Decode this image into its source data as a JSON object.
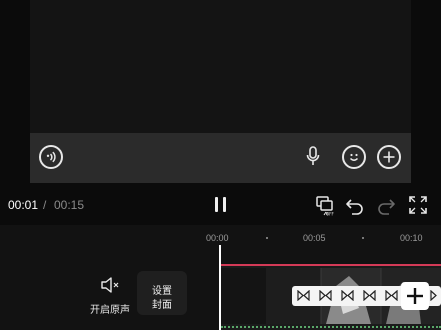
{
  "playback": {
    "current_time": "00:01",
    "separator": "/",
    "total_time": "00:15"
  },
  "timeline": {
    "ruler_labels": [
      "00:00",
      "00:05",
      "00:10"
    ]
  },
  "tools": {
    "mute_original_label": "开启原声",
    "set_cover_label_line1": "设置",
    "set_cover_label_line2": "封面"
  },
  "icons": {
    "voice": "voice-input-icon",
    "mic": "microphone-icon",
    "emoji": "emoji-icon",
    "plus": "plus-icon",
    "pause": "pause-icon",
    "screen_off": "screen-off-icon",
    "undo": "undo-icon",
    "redo": "redo-icon",
    "fullscreen": "fullscreen-icon",
    "mute": "speaker-muted-icon",
    "add_clip": "add-clip-icon",
    "transition": "transition-icon"
  },
  "colors": {
    "accent": "#d43a57",
    "audio_track": "#5aa86a",
    "background": "#0b0b0b",
    "input_bar": "#2b2b2b"
  }
}
